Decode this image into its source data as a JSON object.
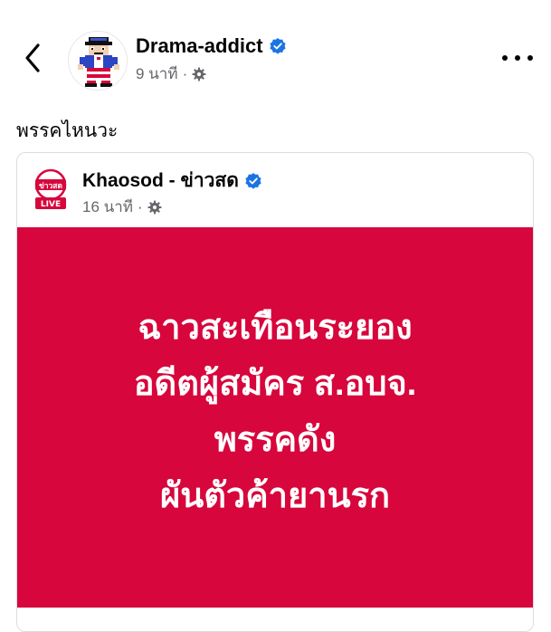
{
  "post": {
    "author": "Drama-addict",
    "time": "9 นาที",
    "separator": "·",
    "text": "พรรคไหนวะ"
  },
  "shared": {
    "author": "Khaosod - ข่าวสด",
    "time": "16 นาที",
    "separator": "·",
    "logo_text": "ข่าวสด",
    "live_label": "LIVE",
    "headline": [
      "ฉาวสะเทือนระยอง",
      "อดีตผู้สมัคร ส.อบจ.",
      "พรรคดัง",
      "ผันตัวค้ายานรก"
    ],
    "headline_bg": "#d7063c"
  },
  "colors": {
    "verified": "#1b74e4",
    "secondary_text": "#65676b"
  },
  "icons": {
    "back": "chevron-left-icon",
    "more": "more-horizontal-icon",
    "privacy": "gear-icon",
    "verified": "verified-badge-icon"
  }
}
